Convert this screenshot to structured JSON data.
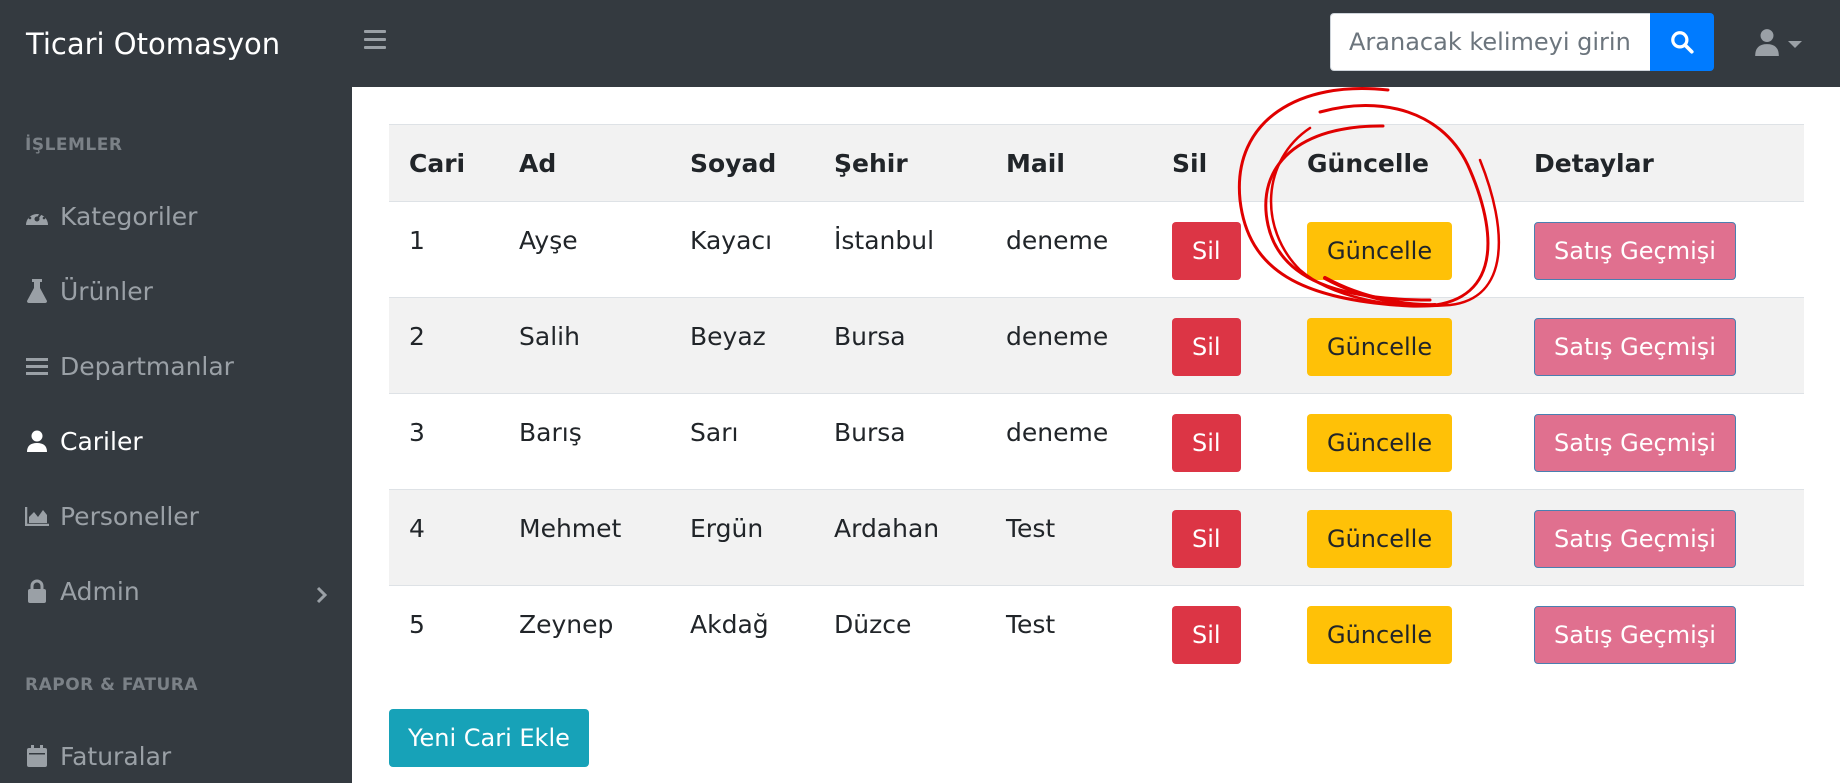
{
  "app": {
    "title": "Ticari Otomasyon"
  },
  "search": {
    "placeholder": "Aranacak kelimeyi girin.."
  },
  "sidebar": {
    "sections": [
      {
        "title": "İŞLEMLER"
      },
      {
        "title": "RAPOR & FATURA"
      }
    ],
    "items": [
      {
        "label": "Kategoriler",
        "icon": "dashboard-gauge-icon"
      },
      {
        "label": "Ürünler",
        "icon": "flask-icon"
      },
      {
        "label": "Departmanlar",
        "icon": "list-lines-icon"
      },
      {
        "label": "Cariler",
        "icon": "user-icon",
        "active": true
      },
      {
        "label": "Personeller",
        "icon": "area-chart-icon"
      },
      {
        "label": "Admin",
        "icon": "lock-icon"
      },
      {
        "label": "Faturalar",
        "icon": "calendar-icon"
      }
    ]
  },
  "table": {
    "headers": [
      "Cari",
      "Ad",
      "Soyad",
      "Şehir",
      "Mail",
      "Sil",
      "Güncelle",
      "Detaylar"
    ],
    "rows": [
      {
        "id": "1",
        "ad": "Ayşe",
        "soyad": "Kayacı",
        "sehir": "İstanbul",
        "mail": "deneme"
      },
      {
        "id": "2",
        "ad": "Salih",
        "soyad": "Beyaz",
        "sehir": "Bursa",
        "mail": "deneme"
      },
      {
        "id": "3",
        "ad": "Barış",
        "soyad": "Sarı",
        "sehir": "Bursa",
        "mail": "deneme"
      },
      {
        "id": "4",
        "ad": "Mehmet",
        "soyad": "Ergün",
        "sehir": "Ardahan",
        "mail": "Test"
      },
      {
        "id": "5",
        "ad": "Zeynep",
        "soyad": "Akdağ",
        "sehir": "Düzce",
        "mail": "Test"
      }
    ],
    "buttons": {
      "delete": "Sil",
      "update": "Güncelle",
      "history": "Satış Geçmişi"
    }
  },
  "actions": {
    "add_label": "Yeni Cari Ekle"
  },
  "colors": {
    "topbar": "#343a40",
    "primary": "#007bff",
    "danger": "#dc3545",
    "warning": "#ffc107",
    "pink": "#e0708f",
    "info": "#17a2b8",
    "annotation": "#e00000"
  }
}
